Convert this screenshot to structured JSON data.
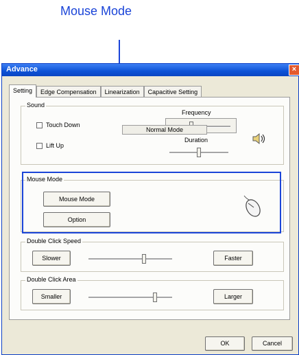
{
  "annotation": {
    "label": "Mouse Mode",
    "color": "#1a44d8"
  },
  "window": {
    "title": "Advance",
    "close_glyph": "×",
    "tabs": [
      "Setting",
      "Edge Compensation",
      "Linearization",
      "Capacitive Setting"
    ],
    "active_tab": "Setting"
  },
  "sound": {
    "group_label": "Sound",
    "touch_down_label": "Touch Down",
    "lift_up_label": "Lift Up",
    "frequency_label": "Frequency",
    "duration_label": "Duration",
    "icon": "speaker-icon"
  },
  "mouse_mode": {
    "group_label": "Mouse Mode",
    "mouse_mode_button": "Mouse Mode",
    "mode_value": "Normal Mode",
    "option_button": "Option",
    "icon": "mouse-icon"
  },
  "double_click_speed": {
    "group_label": "Double Click Speed",
    "slower_button": "Slower",
    "faster_button": "Faster"
  },
  "double_click_area": {
    "group_label": "Double Click Area",
    "smaller_button": "Smaller",
    "larger_button": "Larger"
  },
  "footer": {
    "ok_button": "OK",
    "cancel_button": "Cancel"
  }
}
